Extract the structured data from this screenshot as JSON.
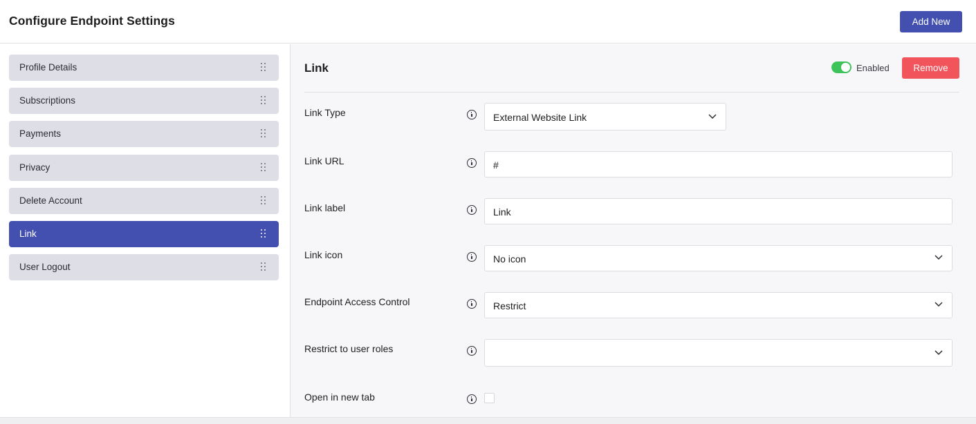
{
  "header": {
    "title": "Configure Endpoint Settings",
    "add_new_label": "Add New"
  },
  "sidebar": {
    "items": [
      {
        "label": "Profile Details",
        "active": false
      },
      {
        "label": "Subscriptions",
        "active": false
      },
      {
        "label": "Payments",
        "active": false
      },
      {
        "label": "Privacy",
        "active": false
      },
      {
        "label": "Delete Account",
        "active": false
      },
      {
        "label": "Link",
        "active": true
      },
      {
        "label": "User Logout",
        "active": false
      }
    ]
  },
  "panel": {
    "title": "Link",
    "enabled": true,
    "enabled_label": "Enabled",
    "remove_label": "Remove",
    "fields": {
      "link_type": {
        "label": "Link Type",
        "value": "External Website Link",
        "icon": "chevron-down-icon"
      },
      "link_url": {
        "label": "Link URL",
        "value": "#"
      },
      "link_label": {
        "label": "Link label",
        "value": "Link"
      },
      "link_icon": {
        "label": "Link icon",
        "value": "No icon",
        "icon": "chevron-down-icon"
      },
      "access_control": {
        "label": "Endpoint Access Control",
        "value": "Restrict",
        "icon": "chevron-down-icon"
      },
      "user_roles": {
        "label": "Restrict to user roles",
        "value": "",
        "icon": "chevron-down-icon"
      },
      "new_tab": {
        "label": "Open in new tab",
        "checked": false
      }
    }
  },
  "colors": {
    "accent": "#4350b0",
    "danger": "#f2545b",
    "toggle_on": "#3ec35a",
    "sidebar_item_bg": "#dedfe6"
  }
}
